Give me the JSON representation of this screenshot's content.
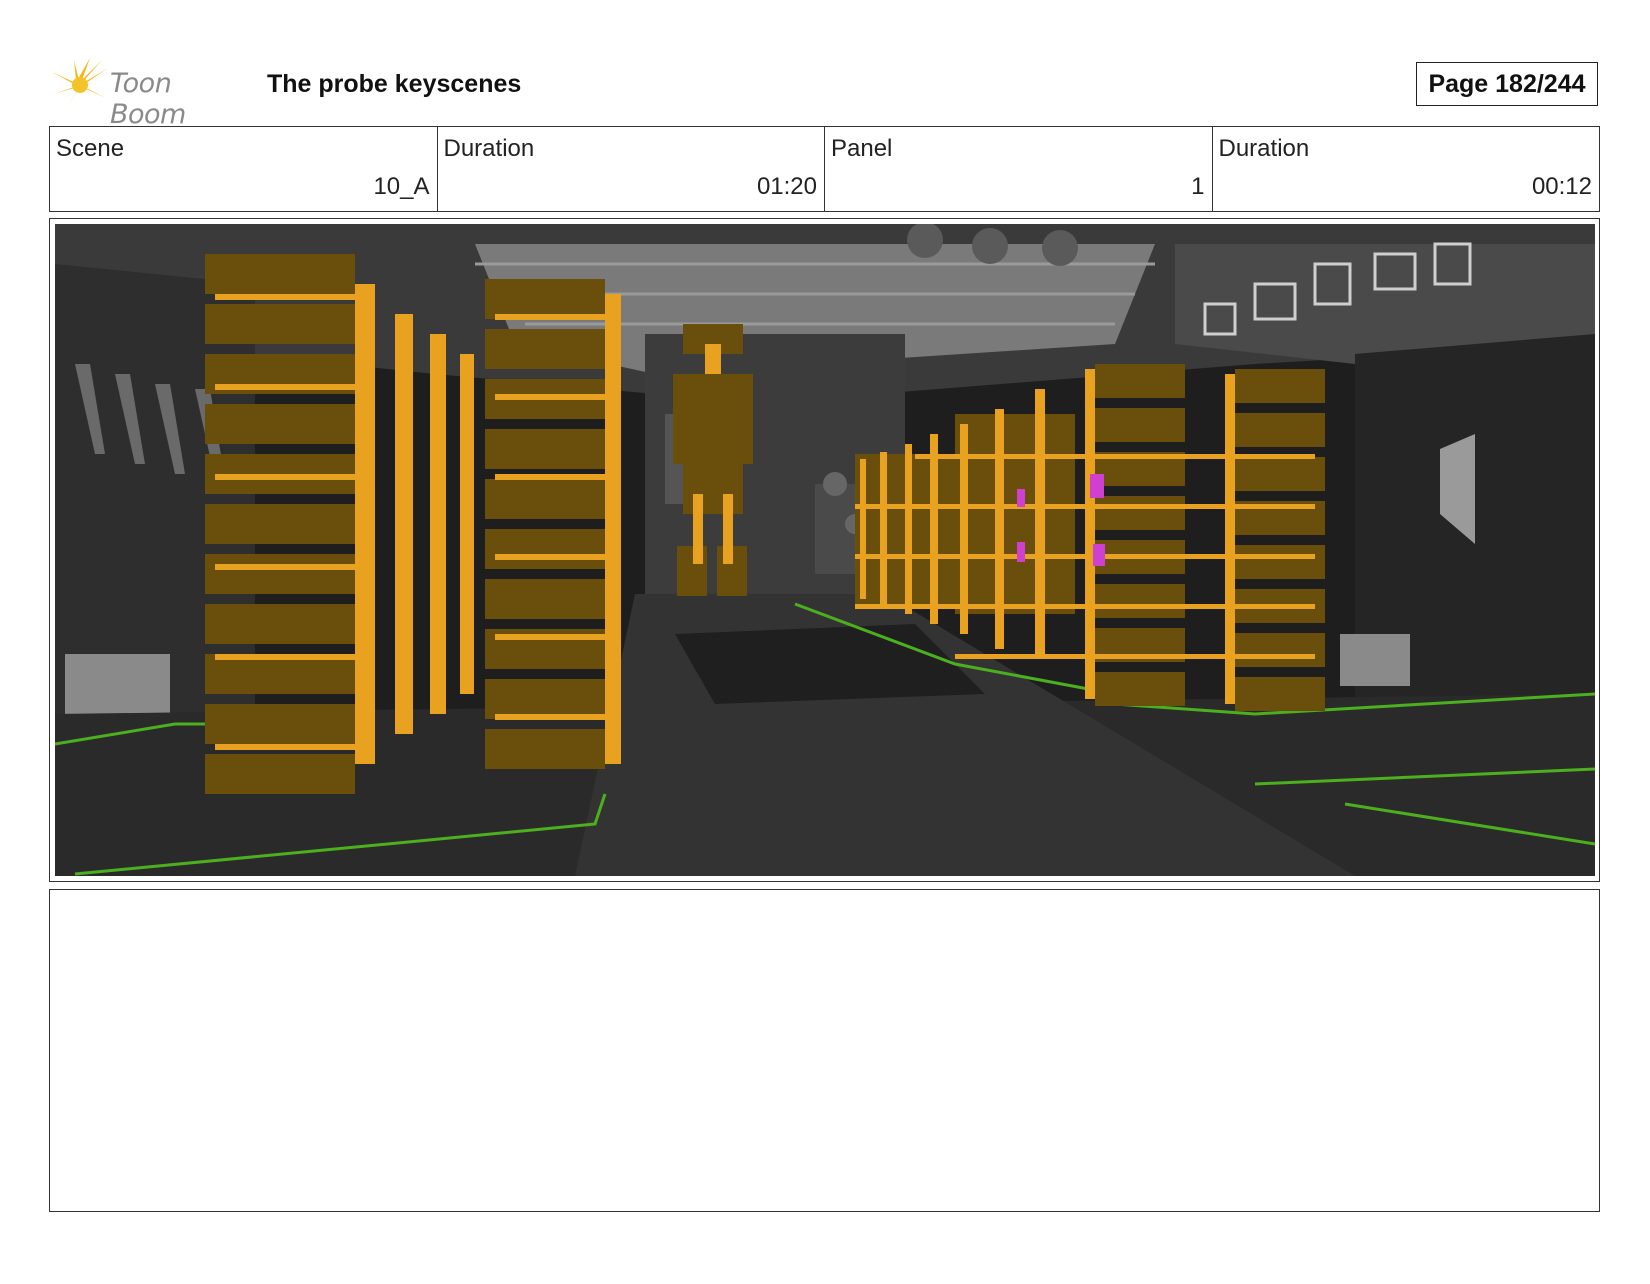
{
  "header": {
    "logo_text": "Toon Boom",
    "title": "The probe keyscenes",
    "page": "Page 182/244"
  },
  "info": {
    "scene_label": "Scene",
    "scene_value": "10_A",
    "scene_duration_label": "Duration",
    "scene_duration_value": "01:20",
    "panel_label": "Panel",
    "panel_value": "1",
    "panel_duration_label": "Duration",
    "panel_duration_value": "00:12"
  },
  "panel": {
    "image_description_icon": "storyboard-frame-image"
  },
  "notes": {
    "text": ""
  },
  "colors": {
    "accent_gold": "#e8a21f",
    "crate_brown": "#6a4e0c",
    "floor_green": "#4caf1e",
    "marker_magenta": "#d040d0"
  }
}
